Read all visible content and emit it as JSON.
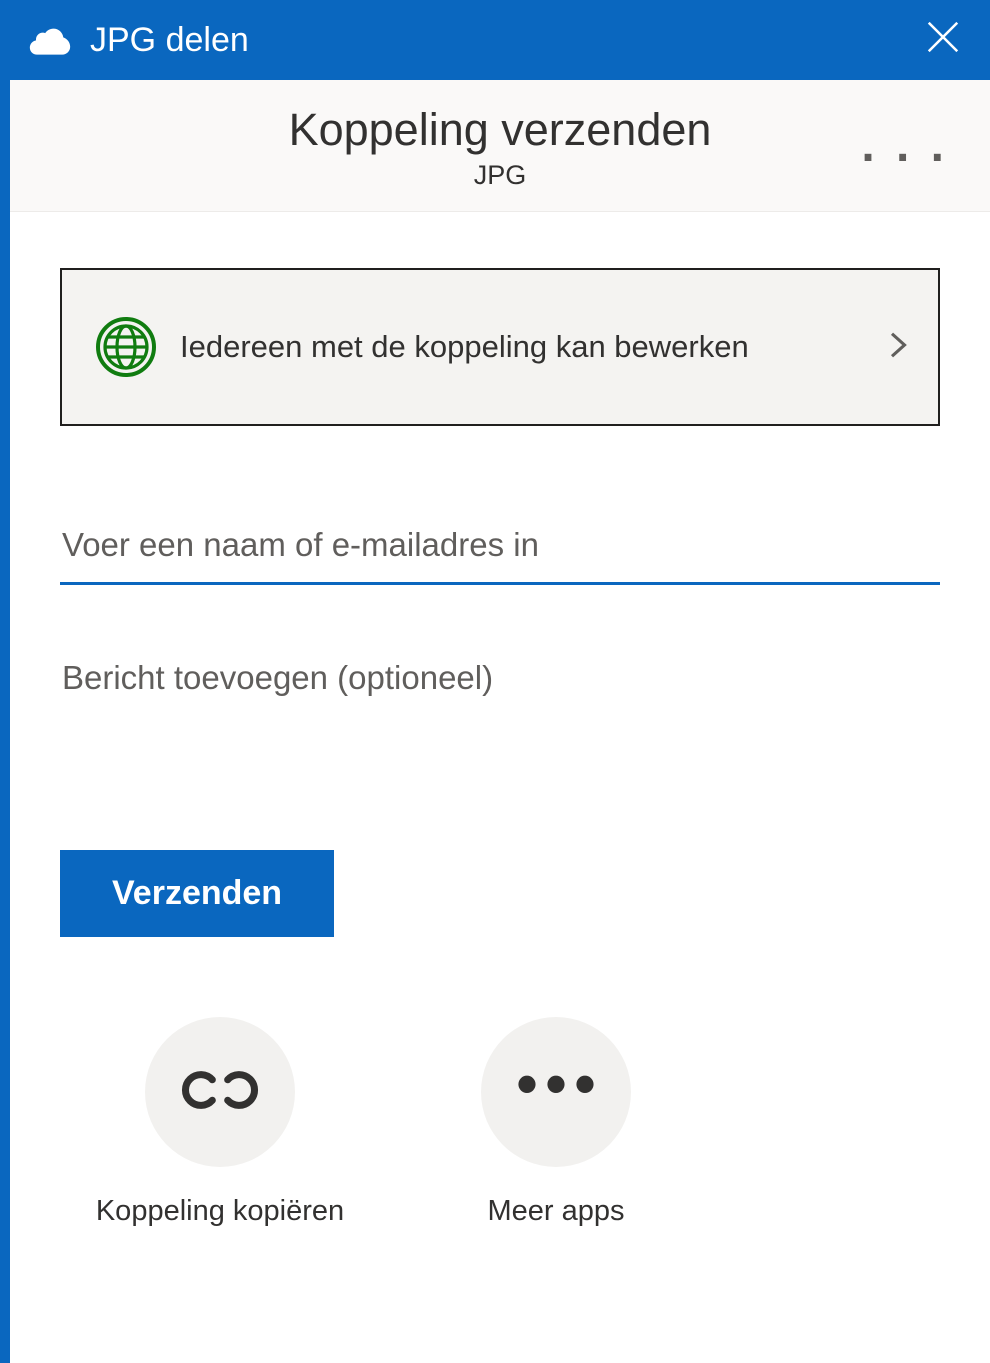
{
  "titlebar": {
    "title": "JPG delen",
    "close_label": "✕"
  },
  "header": {
    "title": "Koppeling verzenden",
    "subtitle": "JPG",
    "more": ". . ."
  },
  "link_settings": {
    "label": "Iedereen met de koppeling kan bewerken"
  },
  "name_input": {
    "placeholder": "Voer een naam of e-mailadres in",
    "value": ""
  },
  "message_input": {
    "placeholder": "Bericht toevoegen (optioneel)",
    "value": ""
  },
  "buttons": {
    "send": "Verzenden"
  },
  "actions": {
    "copy_link": "Koppeling kopiëren",
    "more_apps": "Meer apps"
  },
  "colors": {
    "accent": "#0a67bf",
    "globe_green": "#107c10"
  }
}
